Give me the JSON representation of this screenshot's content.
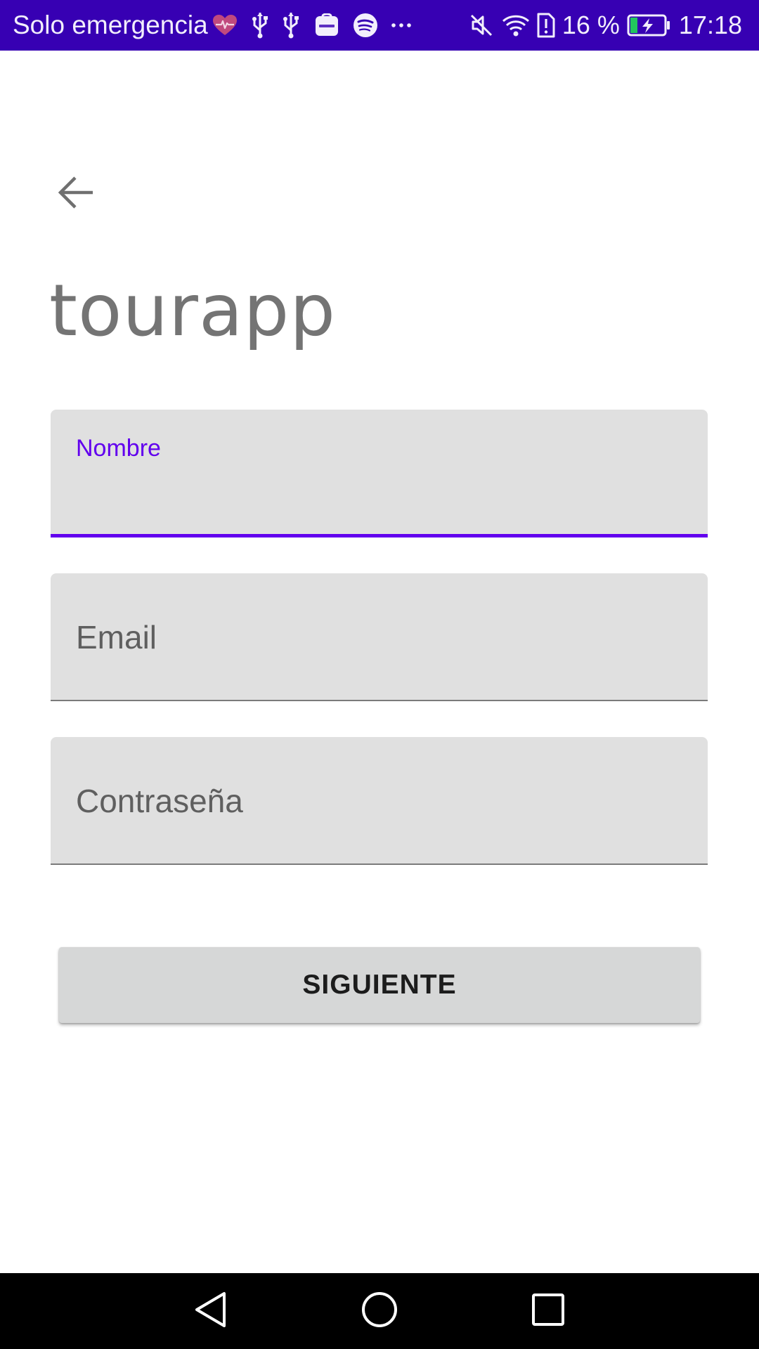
{
  "status_bar": {
    "carrier": "Solo emergencia",
    "battery_percent": "16 %",
    "time": "17:18",
    "icons": [
      "heart-icon",
      "usb-icon",
      "usb-icon",
      "huawei-icon",
      "spotify-icon",
      "more-icon",
      "mute-icon",
      "wifi-icon",
      "sim-alert-icon",
      "battery-charging-icon"
    ]
  },
  "header": {
    "back_icon": "arrow-back-icon",
    "title": "tourapp"
  },
  "form": {
    "nombre_label": "Nombre",
    "nombre_value": "",
    "email_label": "Email",
    "password_label": "Contraseña",
    "submit_label": "SIGUIENTE"
  },
  "nav_bar": {
    "buttons": [
      "back-triangle-icon",
      "home-circle-icon",
      "recents-square-icon"
    ]
  },
  "colors": {
    "status_bar": "#3700b3",
    "accent": "#6200ee",
    "field_background": "#e0e0e0",
    "button_background": "#d6d7d7",
    "title_text": "#747474"
  }
}
